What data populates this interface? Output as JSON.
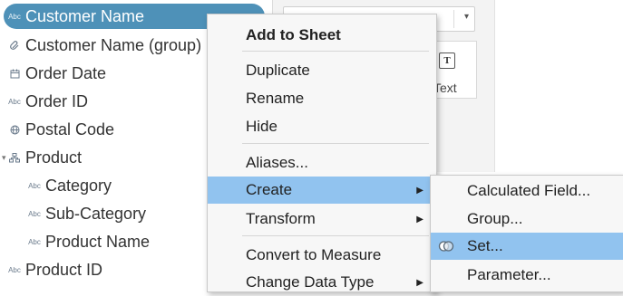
{
  "data_pane": {
    "fields": [
      {
        "label": "Customer Name",
        "type_badge": "Abc",
        "icon": "abc-string-icon"
      },
      {
        "label": "Customer Name (group)",
        "type_badge": "",
        "icon": "paperclip-group-icon"
      },
      {
        "label": "Order Date",
        "type_badge": "",
        "icon": "calendar-icon"
      },
      {
        "label": "Order ID",
        "type_badge": "Abc",
        "icon": "abc-string-icon"
      },
      {
        "label": "Postal Code",
        "type_badge": "",
        "icon": "globe-icon"
      },
      {
        "label": "Product",
        "type_badge": "",
        "icon": "hierarchy-icon"
      },
      {
        "label": "Category",
        "type_badge": "Abc",
        "icon": "abc-string-icon"
      },
      {
        "label": "Sub-Category",
        "type_badge": "Abc",
        "icon": "abc-string-icon"
      },
      {
        "label": "Product Name",
        "type_badge": "Abc",
        "icon": "abc-string-icon"
      },
      {
        "label": "Product ID",
        "type_badge": "Abc",
        "icon": "abc-string-icon"
      }
    ]
  },
  "marks_card": {
    "text_button_label": "Text"
  },
  "context_menu": {
    "items": [
      {
        "label": "Add to Sheet",
        "bold": true
      },
      {
        "label": "Duplicate"
      },
      {
        "label": "Rename"
      },
      {
        "label": "Hide"
      },
      {
        "label": "Aliases..."
      },
      {
        "label": "Create",
        "submenu": true,
        "active": true
      },
      {
        "label": "Transform",
        "submenu": true
      },
      {
        "label": "Convert to Measure"
      },
      {
        "label": "Change Data Type",
        "submenu": true
      }
    ]
  },
  "create_submenu": {
    "items": [
      {
        "label": "Calculated Field..."
      },
      {
        "label": "Group..."
      },
      {
        "label": "Set...",
        "active": true,
        "icon": "set-icon"
      },
      {
        "label": "Parameter..."
      }
    ]
  },
  "colors": {
    "selected_field": "#4e91b8",
    "menu_highlight": "#91c3ef",
    "menu_background": "#f7f7f7"
  }
}
